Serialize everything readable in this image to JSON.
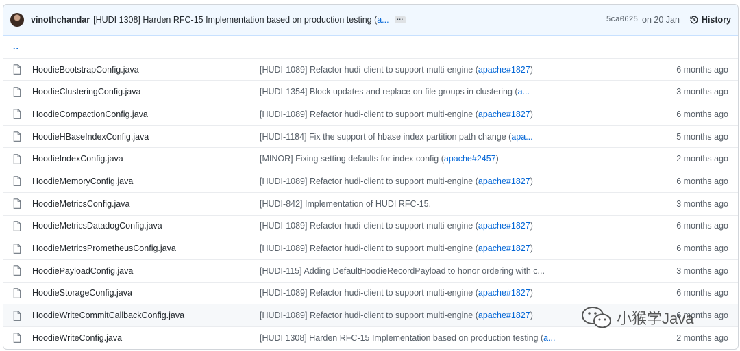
{
  "latest_commit": {
    "author": "vinothchandar",
    "message": "[HUDI 1308] Harden RFC-15 Implementation based on production testing (",
    "message_link": "a...",
    "sha": "5ca0625",
    "date": "on 20 Jan",
    "history_label": "History"
  },
  "up_dir_label": "..",
  "files": [
    {
      "name": "HoodieBootstrapConfig.java",
      "msg": "[HUDI-1089] Refactor hudi-client to support multi-engine (",
      "pr": "apache#1827",
      "tail": ")",
      "age": "6 months ago"
    },
    {
      "name": "HoodieClusteringConfig.java",
      "msg": "[HUDI-1354] Block updates and replace on file groups in clustering (",
      "pr": "a...",
      "tail": "",
      "age": "3 months ago"
    },
    {
      "name": "HoodieCompactionConfig.java",
      "msg": "[HUDI-1089] Refactor hudi-client to support multi-engine (",
      "pr": "apache#1827",
      "tail": ")",
      "age": "6 months ago"
    },
    {
      "name": "HoodieHBaseIndexConfig.java",
      "msg": "[HUDI-1184] Fix the support of hbase index partition path change (",
      "pr": "apa...",
      "tail": "",
      "age": "5 months ago"
    },
    {
      "name": "HoodieIndexConfig.java",
      "msg": "[MINOR] Fixing setting defaults for index config (",
      "pr": "apache#2457",
      "tail": ")",
      "age": "2 months ago"
    },
    {
      "name": "HoodieMemoryConfig.java",
      "msg": "[HUDI-1089] Refactor hudi-client to support multi-engine (",
      "pr": "apache#1827",
      "tail": ")",
      "age": "6 months ago"
    },
    {
      "name": "HoodieMetricsConfig.java",
      "msg": "[HUDI-842] Implementation of HUDI RFC-15.",
      "pr": "",
      "tail": "",
      "age": "3 months ago"
    },
    {
      "name": "HoodieMetricsDatadogConfig.java",
      "msg": "[HUDI-1089] Refactor hudi-client to support multi-engine (",
      "pr": "apache#1827",
      "tail": ")",
      "age": "6 months ago"
    },
    {
      "name": "HoodieMetricsPrometheusConfig.java",
      "msg": "[HUDI-1089] Refactor hudi-client to support multi-engine (",
      "pr": "apache#1827",
      "tail": ")",
      "age": "6 months ago"
    },
    {
      "name": "HoodiePayloadConfig.java",
      "msg": "[HUDI-115] Adding DefaultHoodieRecordPayload to honor ordering with c...",
      "pr": "",
      "tail": "",
      "age": "3 months ago"
    },
    {
      "name": "HoodieStorageConfig.java",
      "msg": "[HUDI-1089] Refactor hudi-client to support multi-engine (",
      "pr": "apache#1827",
      "tail": ")",
      "age": "6 months ago"
    },
    {
      "name": "HoodieWriteCommitCallbackConfig.java",
      "msg": "[HUDI-1089] Refactor hudi-client to support multi-engine (",
      "pr": "apache#1827",
      "tail": ")",
      "age": "6 months ago"
    },
    {
      "name": "HoodieWriteConfig.java",
      "msg": "[HUDI 1308] Harden RFC-15 Implementation based on production testing (",
      "pr": "a...",
      "tail": "",
      "age": "2 months ago"
    }
  ],
  "watermark": {
    "text": "小猴学Java"
  },
  "colors": {
    "link": "#0366d6",
    "header_bg": "#f1f8ff",
    "border": "#d1d5da"
  }
}
